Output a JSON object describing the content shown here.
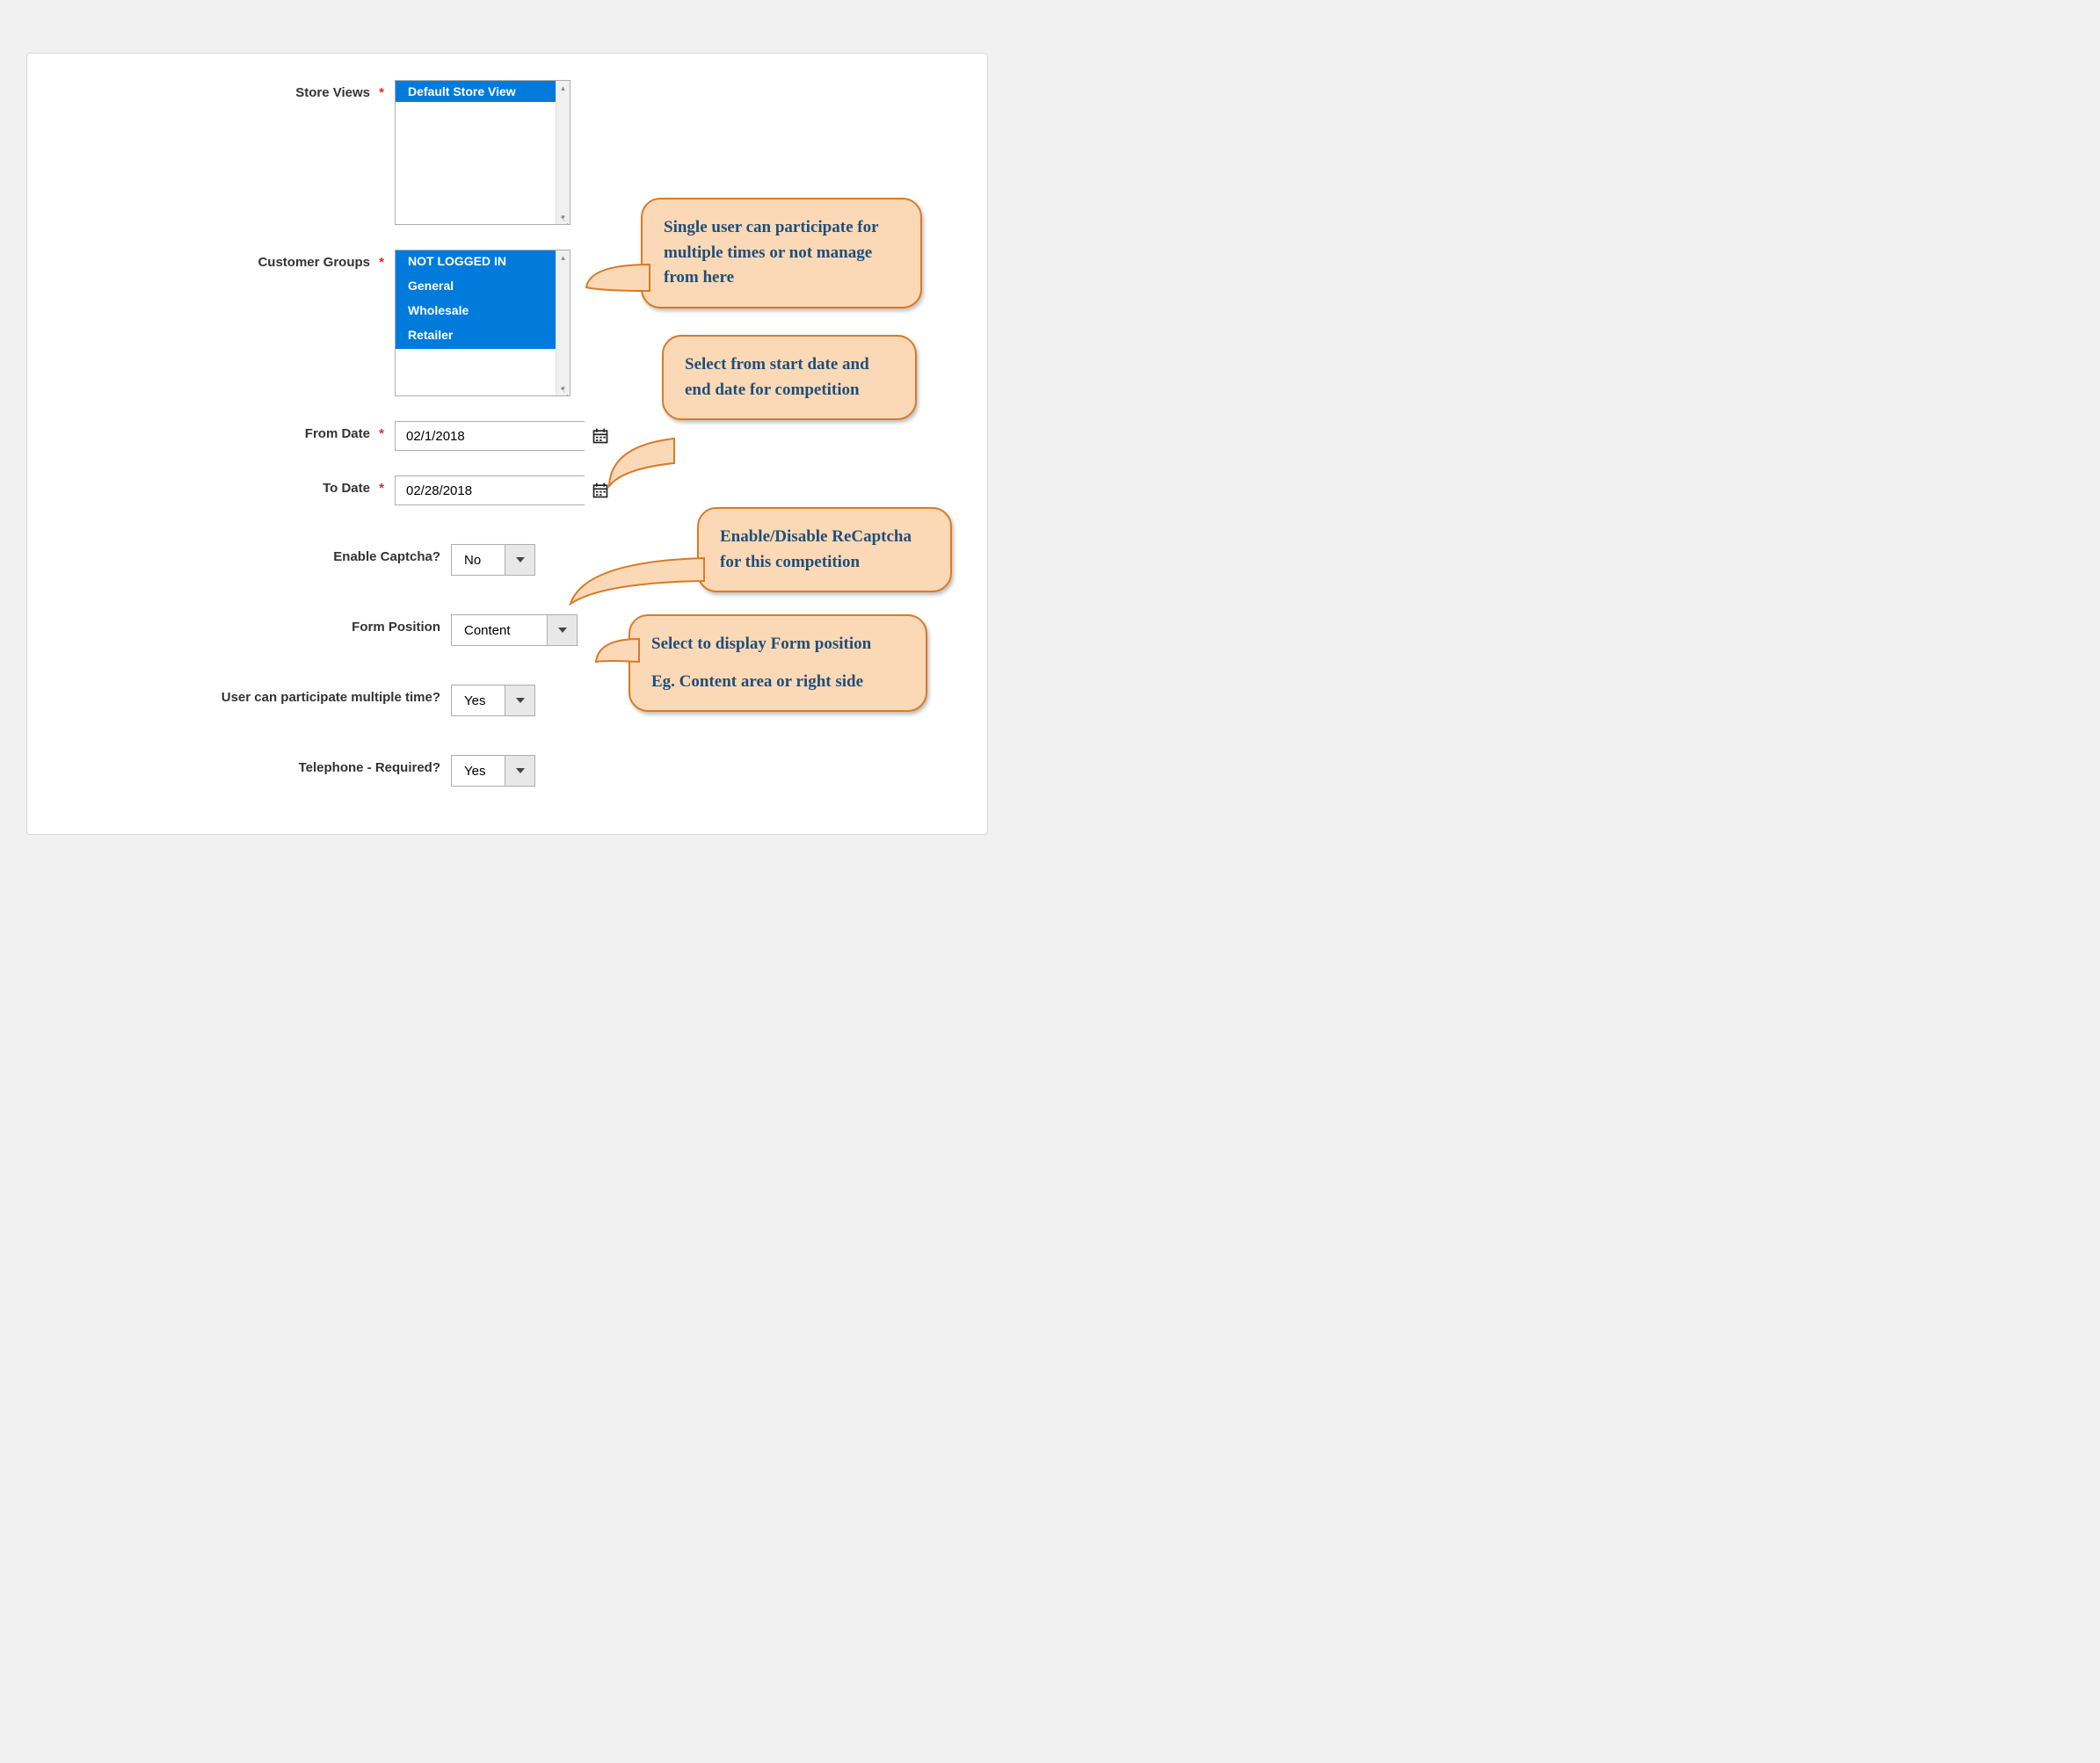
{
  "form": {
    "store_views": {
      "label": "Store Views",
      "options": [
        "Default Store View"
      ]
    },
    "customer_groups": {
      "label": "Customer Groups",
      "options": [
        "NOT LOGGED IN",
        "General",
        "Wholesale",
        "Retailer"
      ]
    },
    "from_date": {
      "label": "From Date",
      "value": "02/1/2018"
    },
    "to_date": {
      "label": "To Date",
      "value": "02/28/2018"
    },
    "enable_captcha": {
      "label": "Enable Captcha?",
      "value": "No"
    },
    "form_position": {
      "label": "Form Position",
      "value": "Content"
    },
    "multi_participate": {
      "label": "User can participate multiple time?",
      "value": "Yes"
    },
    "telephone_required": {
      "label": "Telephone - Required?",
      "value": "Yes"
    }
  },
  "callouts": {
    "multi_user": "Single user can participate for multiple times or not manage from here",
    "date_select": "Select from start date and end date for competition",
    "recaptcha": "Enable/Disable ReCaptcha for this competition",
    "form_position_1": "Select to display Form position",
    "form_position_2": "Eg. Content area or right side"
  }
}
